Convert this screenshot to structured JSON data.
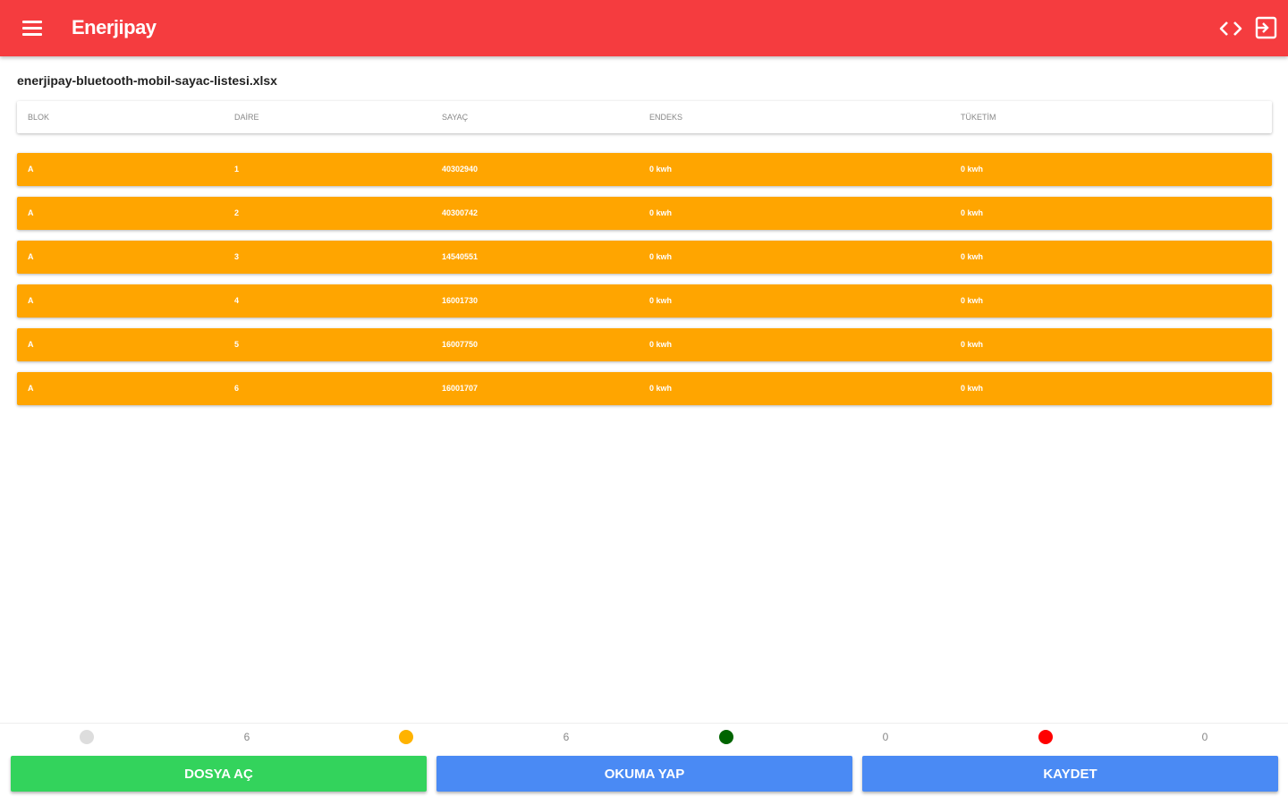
{
  "app": {
    "title": "Enerjipay",
    "icons": {
      "menu": "menu-icon",
      "code": "code-icon",
      "exit": "exit-icon"
    },
    "colors": {
      "appbar": "#f53c3f",
      "row": "#ffa500"
    }
  },
  "file": {
    "name": "enerjipay-bluetooth-mobil-sayac-listesi.xlsx"
  },
  "table": {
    "columns": [
      "BLOK",
      "DAİRE",
      "SAYAÇ",
      "ENDEKS",
      "TÜKETİM"
    ],
    "rows": [
      [
        "A",
        "1",
        "40302940",
        "0 kwh",
        "0 kwh"
      ],
      [
        "A",
        "2",
        "40300742",
        "0 kwh",
        "0 kwh"
      ],
      [
        "A",
        "3",
        "14540551",
        "0 kwh",
        "0 kwh"
      ],
      [
        "A",
        "4",
        "16001730",
        "0 kwh",
        "0 kwh"
      ],
      [
        "A",
        "5",
        "16007750",
        "0 kwh",
        "0 kwh"
      ],
      [
        "A",
        "6",
        "16001707",
        "0 kwh",
        "0 kwh"
      ]
    ]
  },
  "status": [
    {
      "color": "#dddddd",
      "count": "6"
    },
    {
      "color": "#ffb300",
      "count": "6"
    },
    {
      "color": "#006400",
      "count": "0"
    },
    {
      "color": "#ff0000",
      "count": "0"
    }
  ],
  "buttons": {
    "open_file": {
      "label": "DOSYA AÇ",
      "color": "#33d35c"
    },
    "read": {
      "label": "OKUMA YAP",
      "color": "#4a8af4"
    },
    "save": {
      "label": "KAYDET",
      "color": "#4a8af4"
    }
  }
}
